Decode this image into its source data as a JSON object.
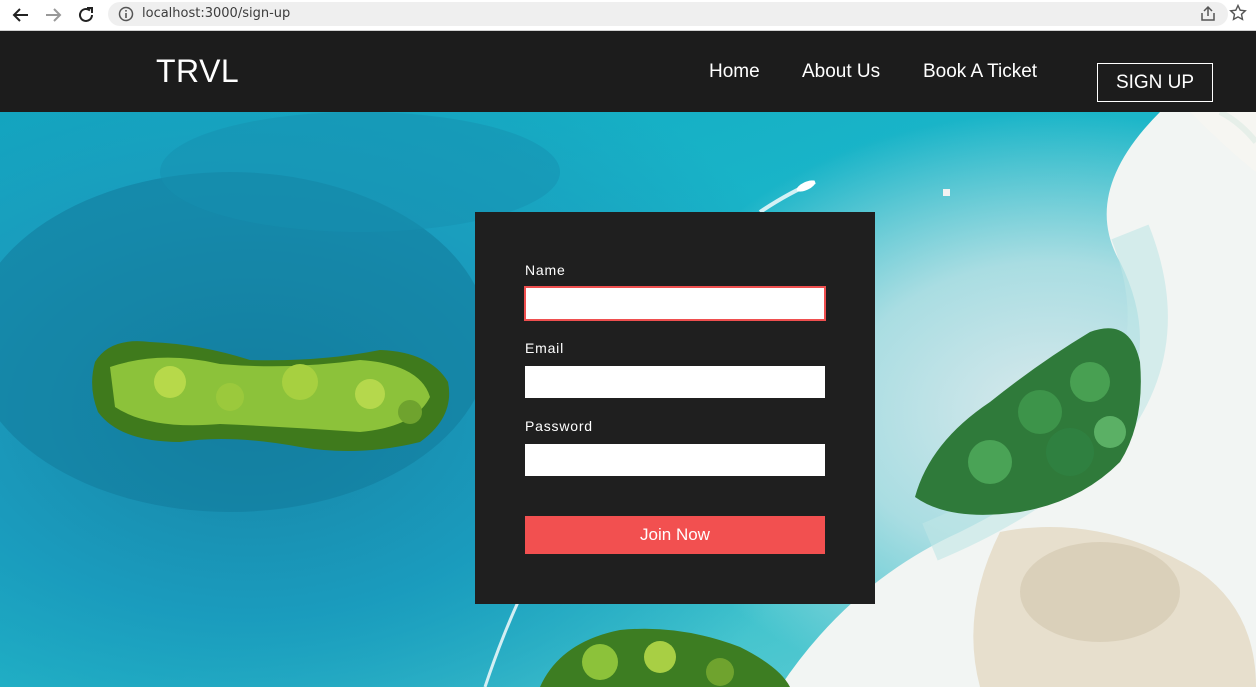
{
  "browser": {
    "url": "localhost:3000/sign-up"
  },
  "navbar": {
    "logo": "TRVL",
    "links": [
      "Home",
      "About Us",
      "Book A Ticket"
    ],
    "signup_label": "SIGN UP"
  },
  "form": {
    "name_label": "Name",
    "name_value": "",
    "email_label": "Email",
    "email_value": "",
    "password_label": "Password",
    "password_value": "",
    "submit_label": "Join Now"
  },
  "colors": {
    "navbar_bg": "#1c1c1c",
    "card_bg": "#1f1f1f",
    "accent": "#f25050",
    "water": "#19b4c8"
  }
}
